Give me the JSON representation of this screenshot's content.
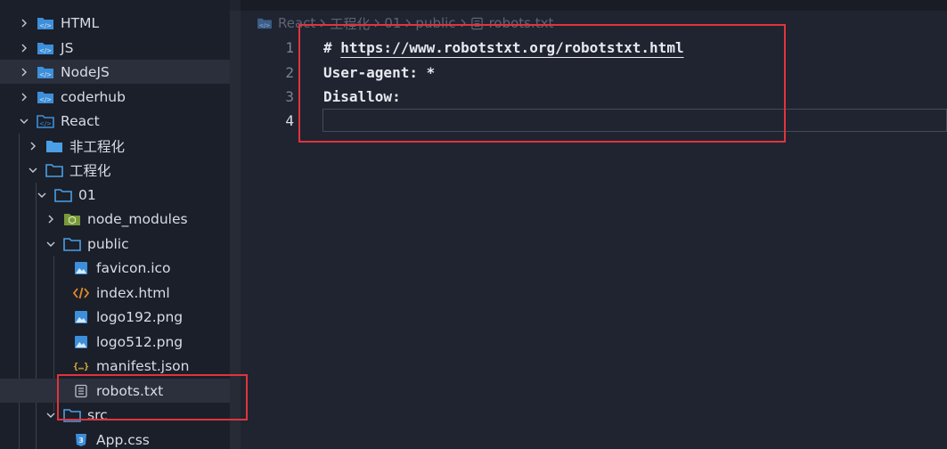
{
  "sidebar": {
    "items": [
      {
        "label": "HTML",
        "icon": "folder-code-icon",
        "chevron": "right"
      },
      {
        "label": "JS",
        "icon": "folder-code-icon",
        "chevron": "right"
      },
      {
        "label": "NodeJS",
        "icon": "folder-code-icon",
        "chevron": "right"
      },
      {
        "label": "coderhub",
        "icon": "folder-code-icon",
        "chevron": "right"
      },
      {
        "label": "React",
        "icon": "folder-code-open-icon",
        "chevron": "down"
      },
      {
        "label": "非工程化",
        "icon": "folder-icon",
        "chevron": "right"
      },
      {
        "label": "工程化",
        "icon": "folder-open-icon",
        "chevron": "down"
      },
      {
        "label": "01",
        "icon": "folder-open-icon",
        "chevron": "down"
      },
      {
        "label": "node_modules",
        "icon": "node-modules-folder-icon",
        "chevron": "right"
      },
      {
        "label": "public",
        "icon": "folder-open-icon",
        "chevron": "down"
      },
      {
        "label": "favicon.ico",
        "icon": "image-file-icon"
      },
      {
        "label": "index.html",
        "icon": "html-file-icon"
      },
      {
        "label": "logo192.png",
        "icon": "image-file-icon"
      },
      {
        "label": "logo512.png",
        "icon": "image-file-icon"
      },
      {
        "label": "manifest.json",
        "icon": "json-file-icon"
      },
      {
        "label": "robots.txt",
        "icon": "text-file-icon"
      },
      {
        "label": "src",
        "icon": "folder-open-icon",
        "chevron": "down"
      },
      {
        "label": "App.css",
        "icon": "css-file-icon"
      }
    ]
  },
  "breadcrumb": {
    "parts": [
      "React",
      "工程化",
      "01",
      "public",
      "robots.txt"
    ]
  },
  "editor": {
    "lines": [
      {
        "number": "1",
        "text": "# ",
        "url": "https://www.robotstxt.org/robotstxt.html"
      },
      {
        "number": "2",
        "text": "User-agent: *"
      },
      {
        "number": "3",
        "text": "Disallow:"
      },
      {
        "number": "4",
        "text": ""
      }
    ]
  },
  "colors": {
    "folder": "#4a9fe6",
    "annotation": "#e0343c",
    "background": "#1f2430",
    "sidebar": "#1b1f29"
  }
}
